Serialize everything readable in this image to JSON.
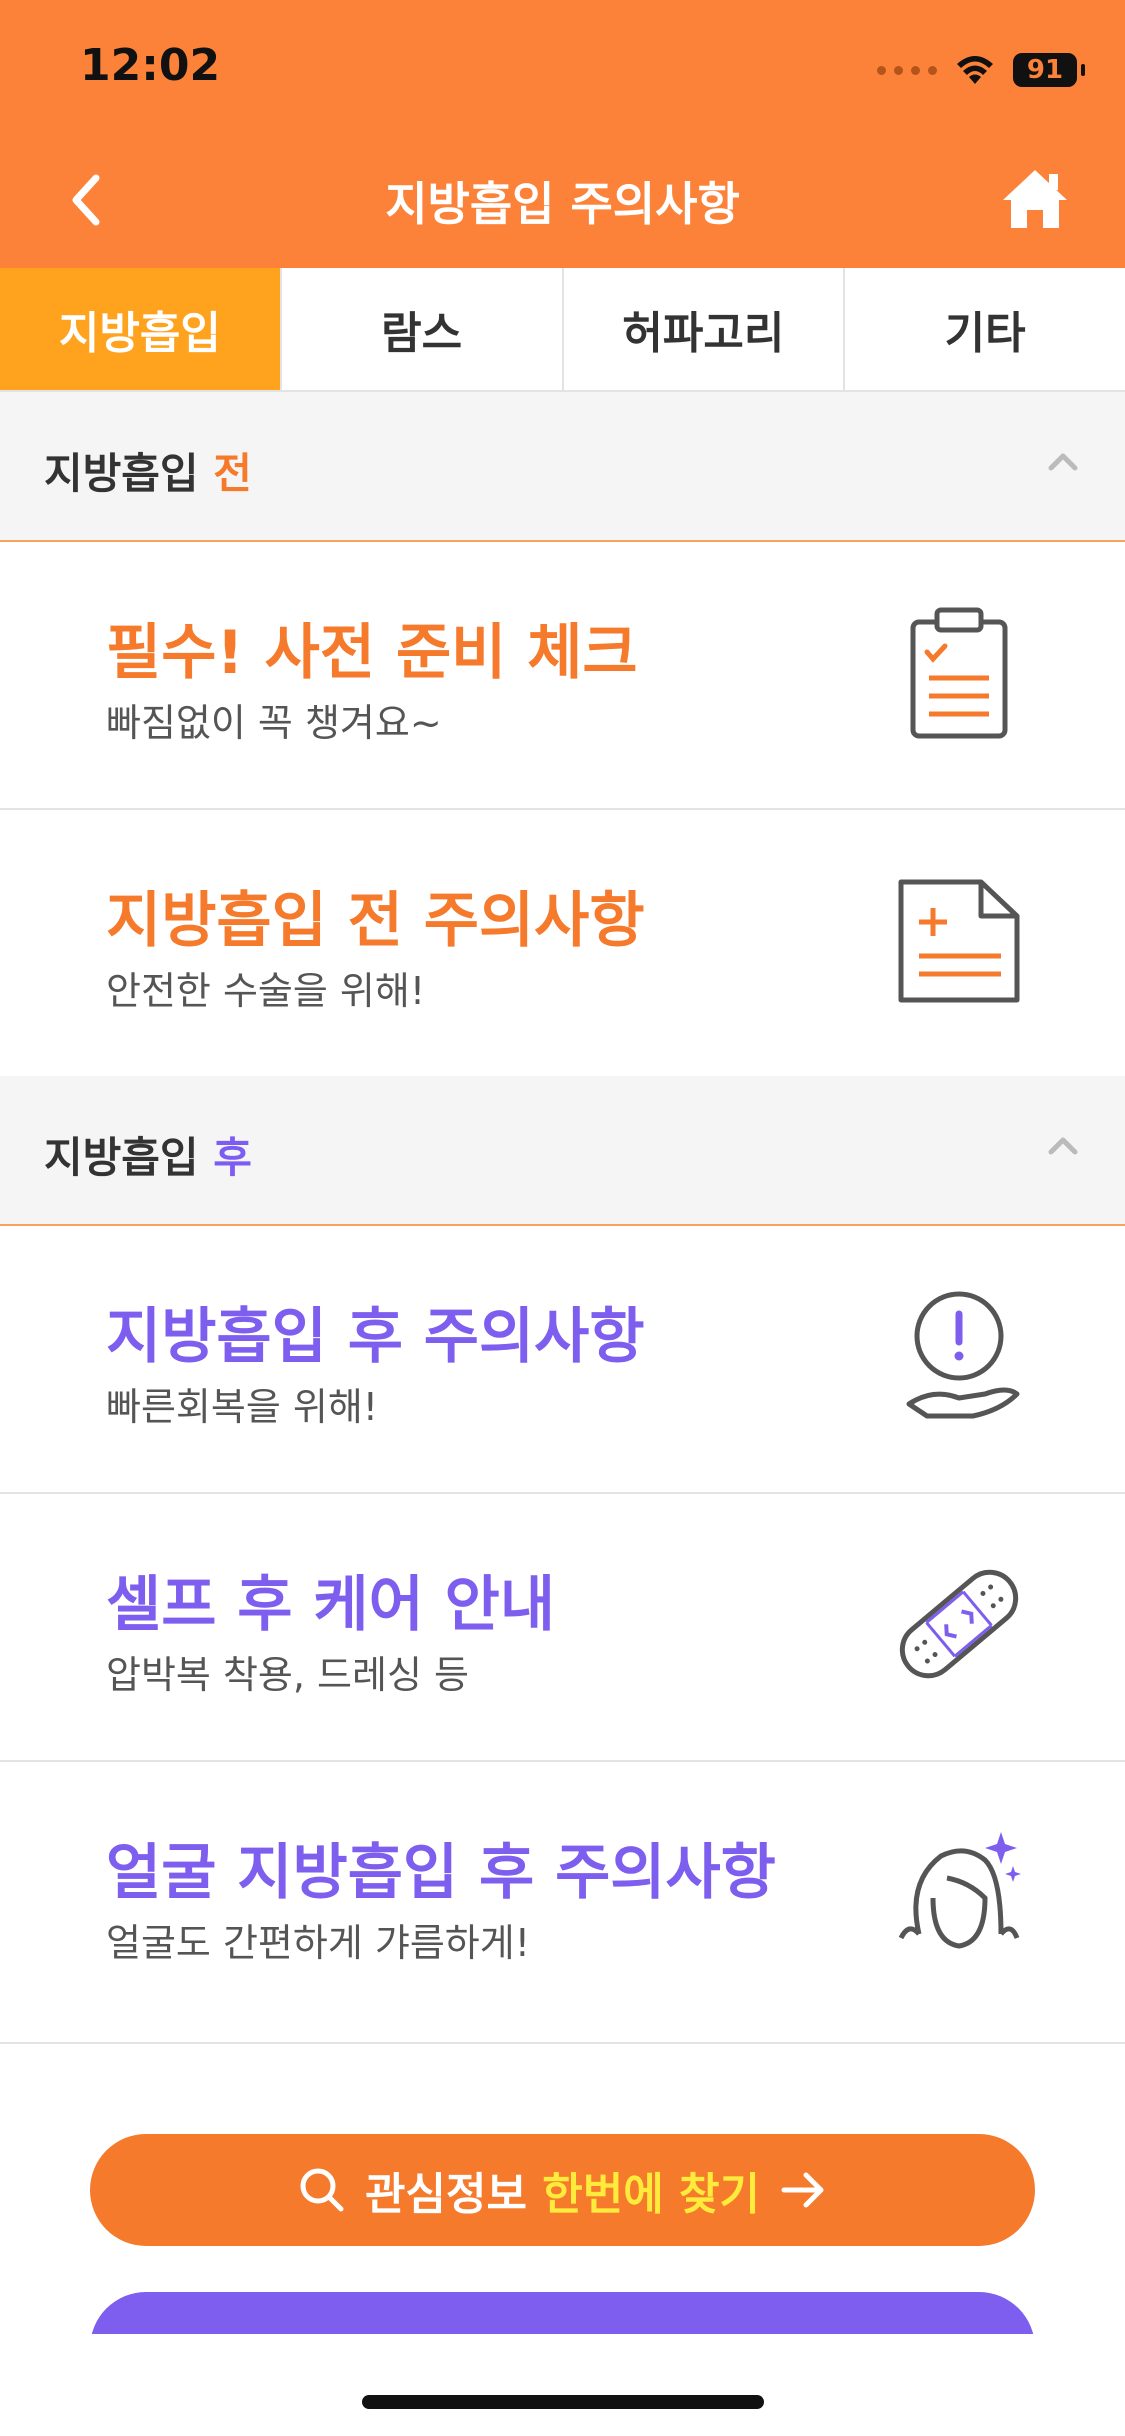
{
  "status_bar": {
    "time": "12:02",
    "battery": "91"
  },
  "header": {
    "title": "지방흡입 주의사항"
  },
  "tabs": [
    {
      "label": "지방흡입",
      "active": true
    },
    {
      "label": "람스",
      "active": false
    },
    {
      "label": "허파고리",
      "active": false
    },
    {
      "label": "기타",
      "active": false
    }
  ],
  "sections": {
    "before": {
      "prefix": "지방흡입 ",
      "accent": "전"
    },
    "after": {
      "prefix": "지방흡입 ",
      "accent": "후"
    }
  },
  "cards": [
    {
      "title": "필수! 사전 준비 체크",
      "subtitle": "빠짐없이 꼭 챙겨요~",
      "icon": "clipboard-check-icon"
    },
    {
      "title": "지방흡입 전 주의사항",
      "subtitle": "안전한 수술을 위해!",
      "icon": "document-plus-icon"
    },
    {
      "title": "지방흡입 후 주의사항",
      "subtitle": "빠른회복을 위해!",
      "icon": "hand-alert-icon"
    },
    {
      "title": "셀프 후 케어 안내",
      "subtitle": "압박복 착용, 드레싱 등",
      "icon": "bandage-icon"
    },
    {
      "title": "얼굴 지방흡입 후 주의사항",
      "subtitle": "얼굴도 간편하게 갸름하게!",
      "icon": "face-sparkle-icon"
    }
  ],
  "search_button": {
    "text_white": "관심정보 ",
    "text_yellow": "한번에 찾기"
  },
  "colors": {
    "header": "#FB8238",
    "active_tab": "#FFA21E",
    "orange": "#F57A2C",
    "purple": "#7D5EEE"
  }
}
